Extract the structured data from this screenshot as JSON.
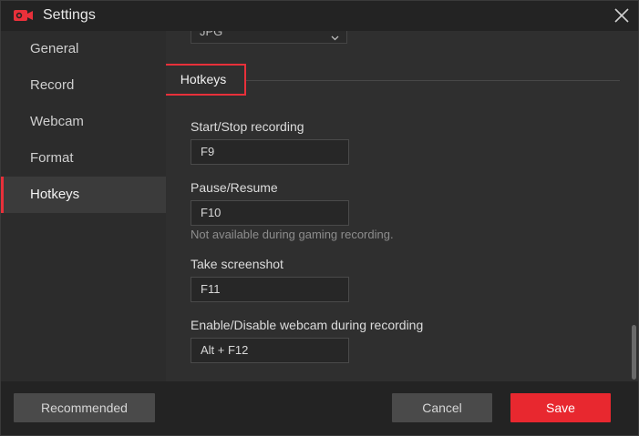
{
  "window": {
    "title": "Settings",
    "app_icon": "screen-recorder-icon",
    "close_icon": "close-icon"
  },
  "sidebar": {
    "items": [
      {
        "label": "General",
        "active": false
      },
      {
        "label": "Record",
        "active": false
      },
      {
        "label": "Webcam",
        "active": false
      },
      {
        "label": "Format",
        "active": false
      },
      {
        "label": "Hotkeys",
        "active": true
      }
    ]
  },
  "format_select": {
    "value": "JPG"
  },
  "hotkeys": {
    "section_title": "Hotkeys",
    "fields": [
      {
        "label": "Start/Stop recording",
        "value": "F9"
      },
      {
        "label": "Pause/Resume",
        "value": "F10",
        "note": "Not available during gaming recording."
      },
      {
        "label": "Take screenshot",
        "value": "F11"
      },
      {
        "label": "Enable/Disable webcam during recording",
        "value": "Alt + F12"
      }
    ]
  },
  "footer": {
    "recommended_label": "Recommended",
    "cancel_label": "Cancel",
    "save_label": "Save"
  },
  "colors": {
    "accent": "#e8303a",
    "save_button": "#e8282f",
    "background": "#2f2f2f",
    "sidebar": "#2c2c2c"
  }
}
